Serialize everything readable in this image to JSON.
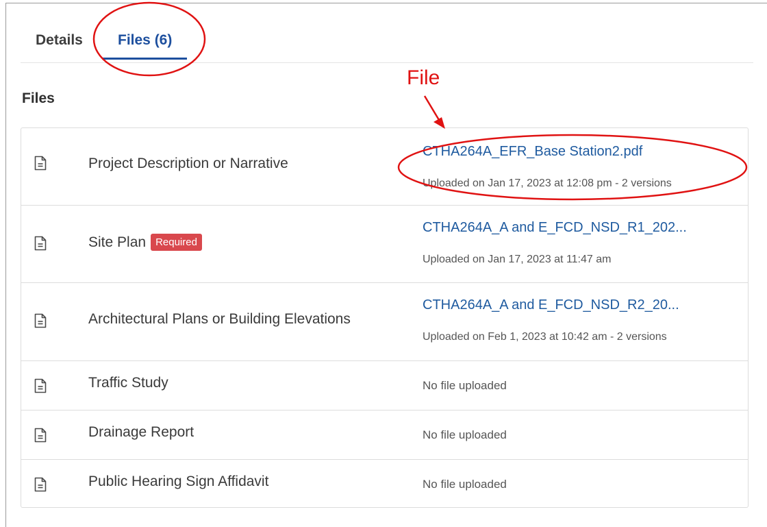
{
  "tabs": [
    {
      "label": "Details",
      "active": false
    },
    {
      "label": "Files (6)",
      "active": true
    }
  ],
  "section": {
    "title": "Files"
  },
  "files": [
    {
      "name": "Project Description or Narrative",
      "required": false,
      "link": "CTHA264A_EFR_Base Station2.pdf",
      "meta": "Uploaded on Jan 17, 2023 at 12:08 pm - 2 versions"
    },
    {
      "name": "Site Plan",
      "required": true,
      "required_label": "Required",
      "link": "CTHA264A_A and E_FCD_NSD_R1_202...",
      "meta": "Uploaded on Jan 17, 2023 at 11:47 am"
    },
    {
      "name": "Architectural Plans or Building Elevations",
      "required": false,
      "link": "CTHA264A_A and E_FCD_NSD_R2_20...",
      "meta": "Uploaded on Feb 1, 2023 at 10:42 am - 2 versions"
    },
    {
      "name": "Traffic Study",
      "required": false,
      "status": "No file uploaded"
    },
    {
      "name": "Drainage Report",
      "required": false,
      "status": "No file uploaded"
    },
    {
      "name": "Public Hearing Sign Affidavit",
      "required": false,
      "status": "No file uploaded"
    }
  ],
  "annotation": {
    "label": "File",
    "color": "#e01212"
  },
  "colors": {
    "link": "#1e5a9f",
    "active_tab": "#1d4f9e",
    "badge": "#d9484d"
  },
  "icons": {
    "file_row": "document-icon"
  }
}
